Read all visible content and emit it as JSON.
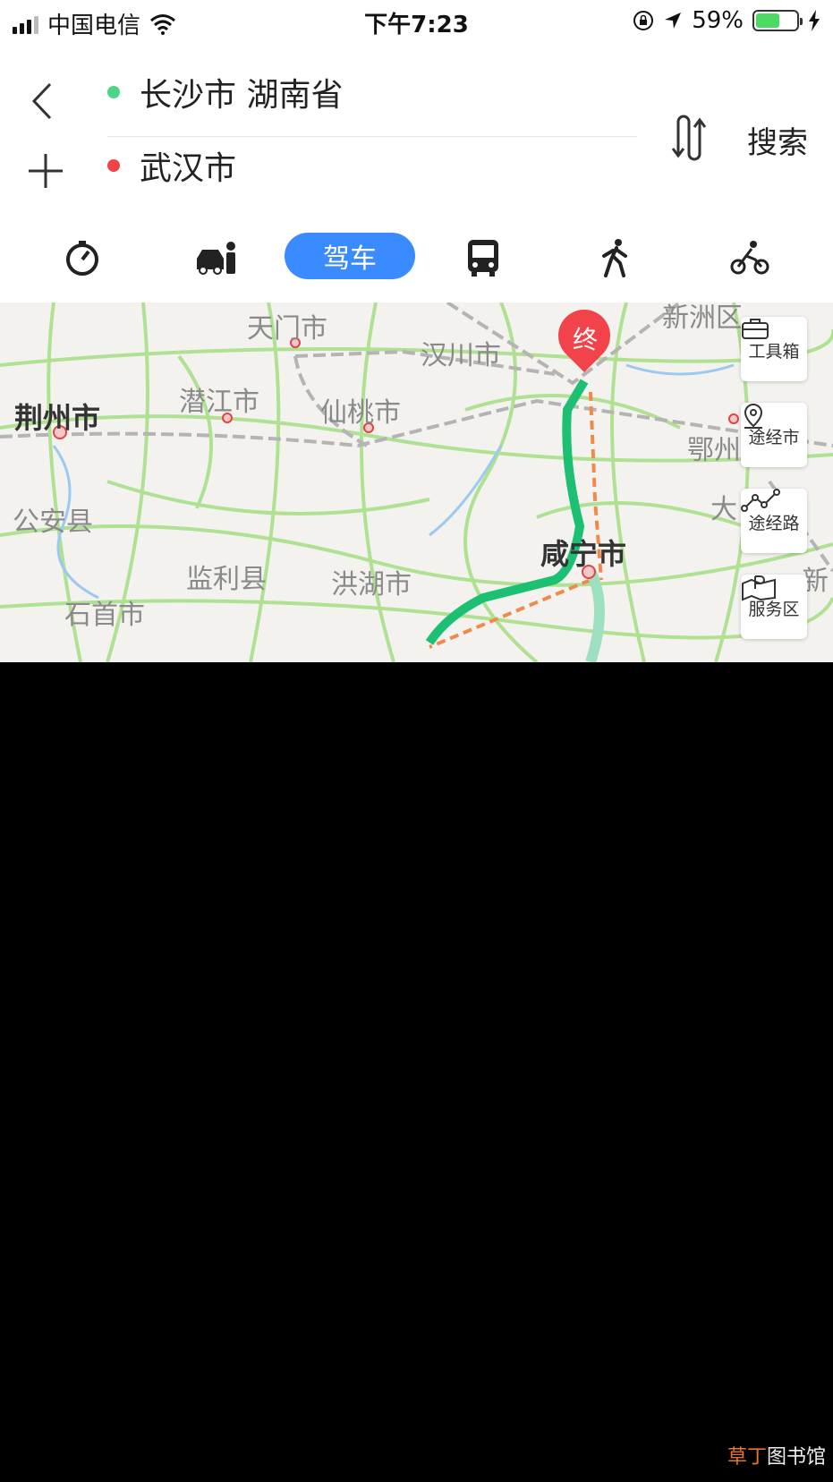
{
  "status_bar": {
    "carrier": "中国电信",
    "time": "下午7:23",
    "battery_percent": "59%",
    "battery_level": 0.59,
    "icons": [
      "signal-icon",
      "wifi-icon",
      "orientation-lock-icon",
      "location-arrow-icon",
      "battery-icon",
      "charging-icon"
    ]
  },
  "route": {
    "start": "长沙市 湖南省",
    "end": "武汉市",
    "start_color": "#4cd48b",
    "end_color": "#f2424a",
    "search_label": "搜索"
  },
  "modes": {
    "active_label": "驾车",
    "items": [
      "stopwatch-icon",
      "taxi-icon",
      "drive",
      "bus-icon",
      "walk-icon",
      "bike-icon"
    ],
    "accent": "#3a8bff"
  },
  "map": {
    "labels": {
      "tianmen": "天门市",
      "hanchuan": "汉川市",
      "xinzhou": "新洲区",
      "jingzhou": "荆州市",
      "qianjiang": "潜江市",
      "xiantao": "仙桃市",
      "ezhou": "鄂州市",
      "gongan": "公安县",
      "xianning": "咸宁市",
      "jianli": "监利县",
      "honghu": "洪湖市",
      "shishou": "石首市",
      "da": "大",
      "xin": "新"
    },
    "end_marker": "终",
    "route_color": "#1dbf73",
    "tools": {
      "toolbox": "工具箱",
      "via_city": "途经市",
      "via_road": "途经路",
      "service_area": "服务区"
    }
  },
  "watermark": {
    "part1": "草丁",
    "part2": "图书馆"
  }
}
